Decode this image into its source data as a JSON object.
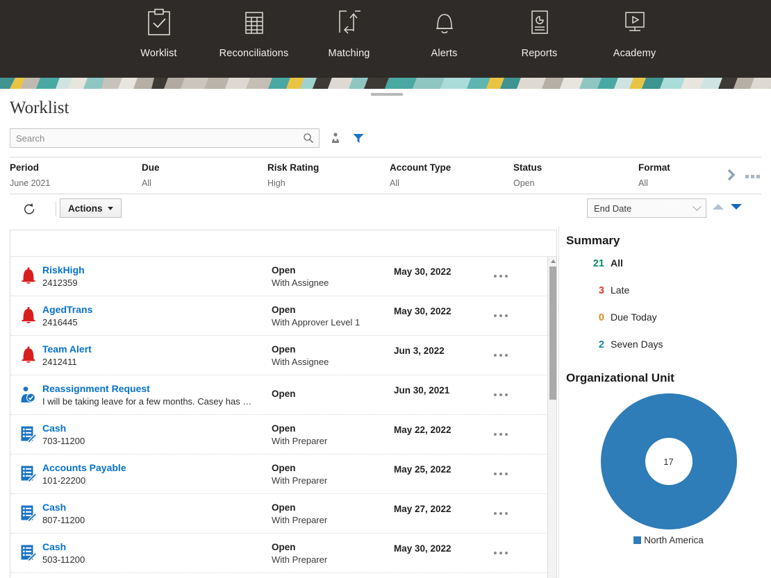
{
  "nav": {
    "items": [
      {
        "label": "Worklist",
        "icon": "clipboard-check-icon"
      },
      {
        "label": "Reconciliations",
        "icon": "table-grid-icon"
      },
      {
        "label": "Matching",
        "icon": "arrows-exchange-icon"
      },
      {
        "label": "Alerts",
        "icon": "bell-icon"
      },
      {
        "label": "Reports",
        "icon": "report-piechart-icon"
      },
      {
        "label": "Academy",
        "icon": "monitor-play-icon"
      }
    ]
  },
  "page": {
    "title": "Worklist"
  },
  "search": {
    "placeholder": "Search",
    "value": ""
  },
  "toolbar": {
    "person_icon": "person-icon",
    "filter_icon": "funnel-filter-icon",
    "refresh_icon": "refresh-icon",
    "actions_label": "Actions",
    "sort_value": "End Date",
    "sort_asc_icon": "sort-ascending-icon",
    "sort_desc_icon": "sort-descending-icon"
  },
  "filters": [
    {
      "name": "Period",
      "value": "June 2021"
    },
    {
      "name": "Due",
      "value": "All"
    },
    {
      "name": "Risk Rating",
      "value": "High"
    },
    {
      "name": "Account Type",
      "value": "All"
    },
    {
      "name": "Status",
      "value": "Open"
    },
    {
      "name": "Format",
      "value": "All"
    }
  ],
  "rows": [
    {
      "icon": "red-bell-icon",
      "title": "RiskHigh",
      "sub": "2412359",
      "status": "Open",
      "status_sub": "With Assignee",
      "date": "May 30, 2022"
    },
    {
      "icon": "red-bell-icon",
      "title": "AgedTrans",
      "sub": "2416445",
      "status": "Open",
      "status_sub": "With Approver Level 1",
      "date": "May 30, 2022"
    },
    {
      "icon": "red-bell-icon",
      "title": "Team Alert",
      "sub": "2412411",
      "status": "Open",
      "status_sub": "With Assignee",
      "date": "Jun 3, 2022"
    },
    {
      "icon": "reassign-user-icon",
      "title": "Reassignment Request",
      "sub": "I will be taking leave for a few months. Casey has …",
      "status": "Open",
      "status_sub": "",
      "date": "Jun 30, 2021"
    },
    {
      "icon": "reconciliation-icon",
      "title": "Cash",
      "sub": "703-11200",
      "status": "Open",
      "status_sub": "With Preparer",
      "date": "May 22, 2022"
    },
    {
      "icon": "reconciliation-icon",
      "title": "Accounts Payable",
      "sub": "101-22200",
      "status": "Open",
      "status_sub": "With Preparer",
      "date": "May 25, 2022"
    },
    {
      "icon": "reconciliation-icon",
      "title": "Cash",
      "sub": "807-11200",
      "status": "Open",
      "status_sub": "With Preparer",
      "date": "May 27, 2022"
    },
    {
      "icon": "reconciliation-icon",
      "title": "Cash",
      "sub": "503-11200",
      "status": "Open",
      "status_sub": "With Preparer",
      "date": "May 30, 2022"
    }
  ],
  "summary": {
    "heading": "Summary",
    "items": [
      {
        "count": "21",
        "label": "All",
        "color": "#0f8a6a"
      },
      {
        "count": "3",
        "label": "Late",
        "color": "#d63b28"
      },
      {
        "count": "0",
        "label": "Due Today",
        "color": "#e08a1e"
      },
      {
        "count": "2",
        "label": "Seven Days",
        "color": "#0e8a9e"
      }
    ]
  },
  "org_unit": {
    "heading": "Organizational Unit",
    "center_value": "17"
  },
  "chart_data": {
    "type": "pie",
    "title": "Organizational Unit",
    "subtype": "donut",
    "categories": [
      "North America"
    ],
    "values": [
      17
    ],
    "total": 17,
    "center_label": "17",
    "colors": [
      "#2e7cb8"
    ],
    "legend": [
      "North America"
    ],
    "legend_position": "bottom"
  },
  "colors": {
    "nav_bg": "#2e2a27",
    "link": "#0572ce",
    "accent_blue": "#1a73c4",
    "alert_red": "#d81f1f",
    "donut_blue": "#2e7cb8"
  }
}
